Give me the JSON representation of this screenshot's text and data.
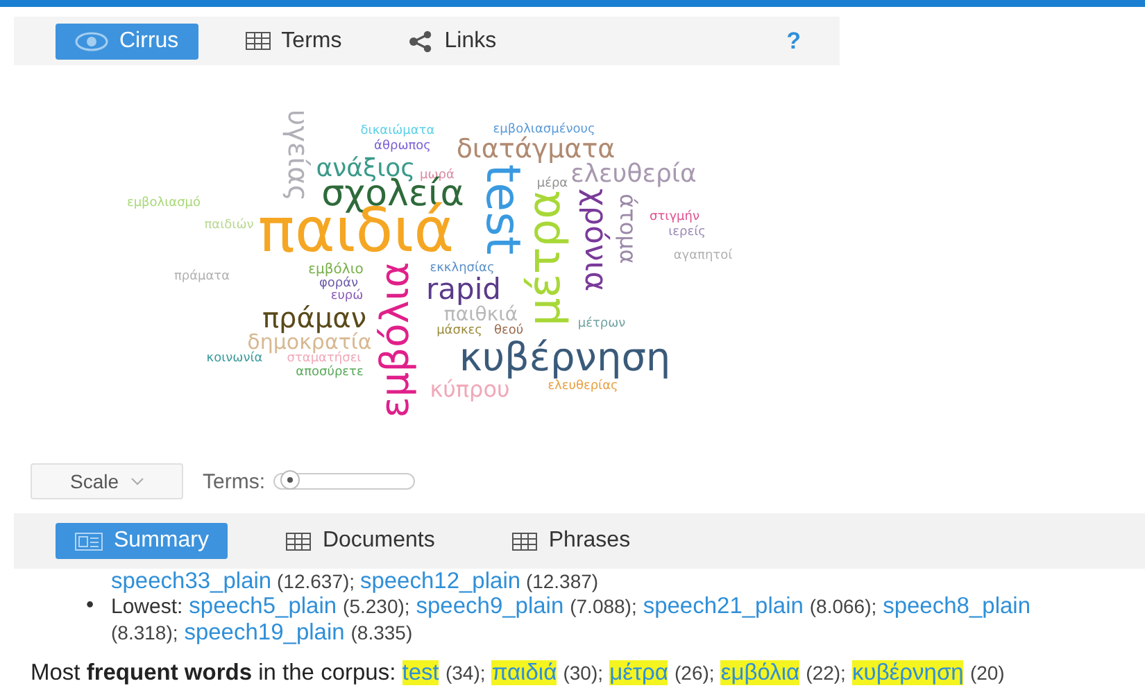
{
  "top_tabs": [
    {
      "label": "Cirrus",
      "selected": true
    },
    {
      "label": "Terms",
      "selected": false
    },
    {
      "label": "Links",
      "selected": false
    }
  ],
  "help": "?",
  "cloud": [
    {
      "text": "υγείας",
      "color": "#b0b0b8",
      "kind": "down"
    },
    {
      "text": "δικαιώματα",
      "color": "#5bd0e8",
      "kind": "flat"
    },
    {
      "text": "εμβολιασμένους",
      "color": "#5a9ad8",
      "kind": "flat"
    },
    {
      "text": "άθρωπος",
      "color": "#7a5cd6",
      "kind": "flat"
    },
    {
      "text": "διατάγματα",
      "color": "#b08a70",
      "kind": "flat"
    },
    {
      "text": "ανάξιος",
      "color": "#3a9a8a",
      "kind": "flat"
    },
    {
      "text": "μωρά",
      "color": "#d88aa0",
      "kind": "flat"
    },
    {
      "text": "test",
      "color": "#3a9ae0",
      "kind": "down"
    },
    {
      "text": "ελευθερία",
      "color": "#a898b0",
      "kind": "flat"
    },
    {
      "text": "σχολεία",
      "color": "#2e6a3a",
      "kind": "flat"
    },
    {
      "text": "μέρα",
      "color": "#909090",
      "kind": "flat"
    },
    {
      "text": "εμβολιασμό",
      "color": "#a8d878",
      "kind": "flat"
    },
    {
      "text": "παιδιών",
      "color": "#b8d890",
      "kind": "flat"
    },
    {
      "text": "παιδιά",
      "color": "#f5a623",
      "kind": "flat"
    },
    {
      "text": "μέτρα",
      "color": "#a8d838",
      "kind": "up"
    },
    {
      "text": "χρόνια",
      "color": "#7a3a9a",
      "kind": "down"
    },
    {
      "text": "άτομα",
      "color": "#9a88a8",
      "kind": "down"
    },
    {
      "text": "στιγμήν",
      "color": "#e05090",
      "kind": "flat"
    },
    {
      "text": "ιερείς",
      "color": "#9a88b8",
      "kind": "flat"
    },
    {
      "text": "αγαπητοί",
      "color": "#b0b0b0",
      "kind": "flat"
    },
    {
      "text": "πράματα",
      "color": "#b0b0b0",
      "kind": "flat"
    },
    {
      "text": "εμβόλιο",
      "color": "#78b048",
      "kind": "flat"
    },
    {
      "text": "εκκλησίας",
      "color": "#5a90c8",
      "kind": "flat"
    },
    {
      "text": "φοράν",
      "color": "#6a5aa8",
      "kind": "flat"
    },
    {
      "text": "ευρώ",
      "color": "#8a5ab8",
      "kind": "flat"
    },
    {
      "text": "rapid",
      "color": "#5a3a8a",
      "kind": "flat"
    },
    {
      "text": "εμβόλια",
      "color": "#e0208a",
      "kind": "up"
    },
    {
      "text": "πράμαν",
      "color": "#5a4a1a",
      "kind": "flat"
    },
    {
      "text": "παιθκιά",
      "color": "#b8b8b8",
      "kind": "flat"
    },
    {
      "text": "μέτρων",
      "color": "#70a0a0",
      "kind": "flat"
    },
    {
      "text": "δημοκρατία",
      "color": "#d8b890",
      "kind": "flat"
    },
    {
      "text": "μάσκες",
      "color": "#9a8a3a",
      "kind": "flat"
    },
    {
      "text": "θεού",
      "color": "#9a6a4a",
      "kind": "flat"
    },
    {
      "text": "κοινωνία",
      "color": "#3a9a9a",
      "kind": "flat"
    },
    {
      "text": "σταματήσει",
      "color": "#f0a8b8",
      "kind": "flat"
    },
    {
      "text": "αποσύρετε",
      "color": "#58a858",
      "kind": "flat"
    },
    {
      "text": "κυβέρνηση",
      "color": "#3a5a7a",
      "kind": "flat"
    },
    {
      "text": "κύπρου",
      "color": "#f0a8b8",
      "kind": "flat"
    },
    {
      "text": "ελευθερίας",
      "color": "#e8a040",
      "kind": "flat"
    }
  ],
  "scale_select": {
    "value": "Scale"
  },
  "terms_slider": {
    "label": "Terms:",
    "level": 0.05
  },
  "bottom_tabs": [
    {
      "label": "Summary",
      "selected": true
    },
    {
      "label": "Documents",
      "selected": false
    },
    {
      "label": "Phrases",
      "selected": false
    }
  ],
  "summary": {
    "cut_line": [
      {
        "doc": "speech33_plain",
        "value": "(12.637);"
      },
      {
        "doc": "speech12_plain",
        "value": "(12.387)"
      }
    ],
    "lowest": {
      "bullet": "•",
      "label": "Lowest:",
      "items": [
        {
          "doc": "speech5_plain",
          "value": "(5.230);"
        },
        {
          "doc": "speech9_plain",
          "value": "(7.088);"
        },
        {
          "doc": "speech21_plain",
          "value": "(8.066);"
        },
        {
          "doc": "speech8_plain",
          "value": "(8.318);"
        },
        {
          "doc": "speech19_plain",
          "value": "(8.335)"
        }
      ]
    },
    "frequent": {
      "prefix": "Most **frequent words** in the corpus:",
      "words": [
        {
          "word": "test",
          "count": "(34);"
        },
        {
          "word": "παιδιά",
          "count": "(30);"
        },
        {
          "word": "μέτρα",
          "count": "(26);"
        },
        {
          "word": "εμβόλια",
          "count": "(22);"
        },
        {
          "word": "κυβέρνηση",
          "count": "(20)"
        }
      ]
    }
  }
}
